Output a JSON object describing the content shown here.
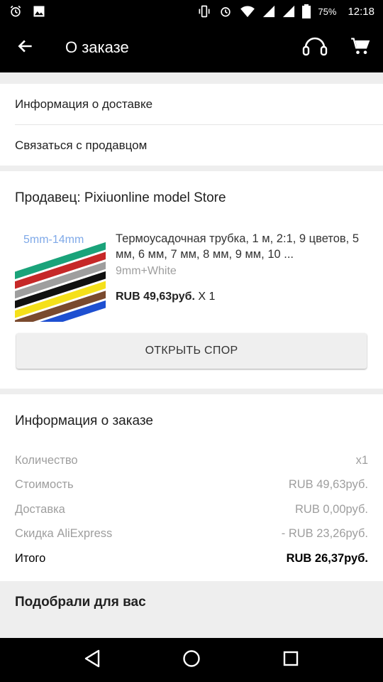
{
  "status_bar": {
    "battery_percent": "75%",
    "time": "12:18"
  },
  "header": {
    "title": "О заказе",
    "icons": [
      "back-arrow-icon",
      "support-headset-icon",
      "cart-icon"
    ]
  },
  "links": {
    "delivery_info": "Информация о доставке",
    "contact_seller": "Связаться с продавцом"
  },
  "seller": {
    "title": "Продавец: Pixiuonline model Store",
    "product": {
      "image_label": "5mm-14mm",
      "title": "Термоусадочная трубка, 1 м, 2:1, 9 цветов, 5 мм, 6 мм, 7 мм, 8 мм, 9 мм, 10 ...",
      "sku": "9mm+White",
      "price": "RUB 49,63руб.",
      "quantity": "X 1"
    },
    "dispute_button": "ОТКРЫТЬ СПОР"
  },
  "order_info": {
    "title": "Информация о заказе",
    "rows": [
      {
        "label": "Количество",
        "value": "x1"
      },
      {
        "label": "Стоимость",
        "value": "RUB 49,63руб."
      },
      {
        "label": "Доставка",
        "value": "RUB 0,00руб."
      },
      {
        "label": "Скидка AliExpress",
        "value": "- RUB 23,26руб."
      }
    ],
    "total": {
      "label": "Итого",
      "value": "RUB 26,37руб."
    }
  },
  "recommend": {
    "title": "Подобрали для вас"
  },
  "colors": {
    "bar_background": "#000000",
    "page_background": "#eeeeee",
    "tube_colors": [
      "#1aa37a",
      "#c62828",
      "#9e9e9e",
      "#000000",
      "#f5e01a",
      "#7a4a2e",
      "#1e4fd1"
    ]
  }
}
